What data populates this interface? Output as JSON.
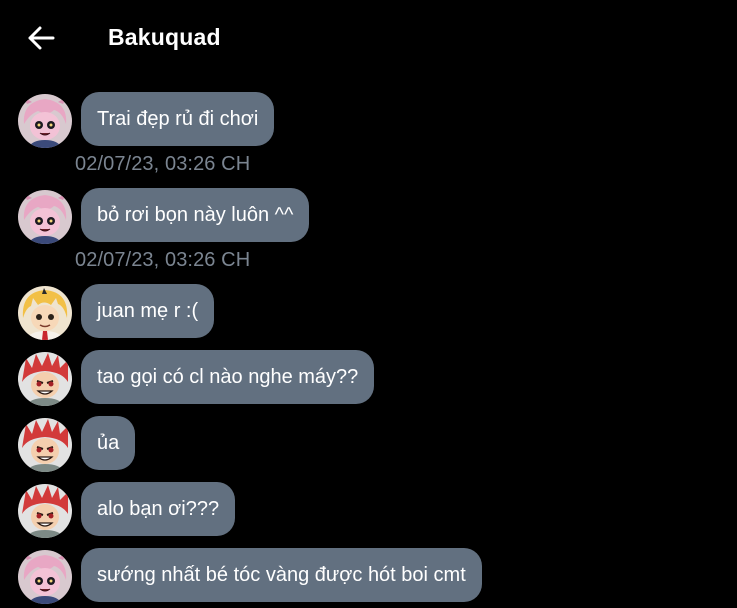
{
  "header": {
    "title": "Bakuquad",
    "back_icon": "arrow-left-icon"
  },
  "colors": {
    "background": "#000000",
    "bubble": "#627080",
    "timestamp": "#7b8591",
    "text": "#ffffff"
  },
  "messages": [
    {
      "text": "Trai đẹp rủ đi chơi",
      "avatar": "pink-hair-avatar",
      "timestamp": "02/07/23, 03:26 CH"
    },
    {
      "text": "bỏ rơi bọn này luôn ^^",
      "avatar": "pink-hair-avatar",
      "timestamp": "02/07/23, 03:26 CH"
    },
    {
      "text": "juan mẹ r :(",
      "avatar": "blonde-hair-avatar"
    },
    {
      "text": "tao gọi có cl nào nghe máy??",
      "avatar": "red-hair-avatar"
    },
    {
      "text": "ủa",
      "avatar": "red-hair-avatar"
    },
    {
      "text": "alo bạn ơi???",
      "avatar": "red-hair-avatar"
    },
    {
      "text": "sướng nhất bé tóc vàng được hót boi cmt",
      "avatar": "pink-hair-avatar"
    }
  ]
}
